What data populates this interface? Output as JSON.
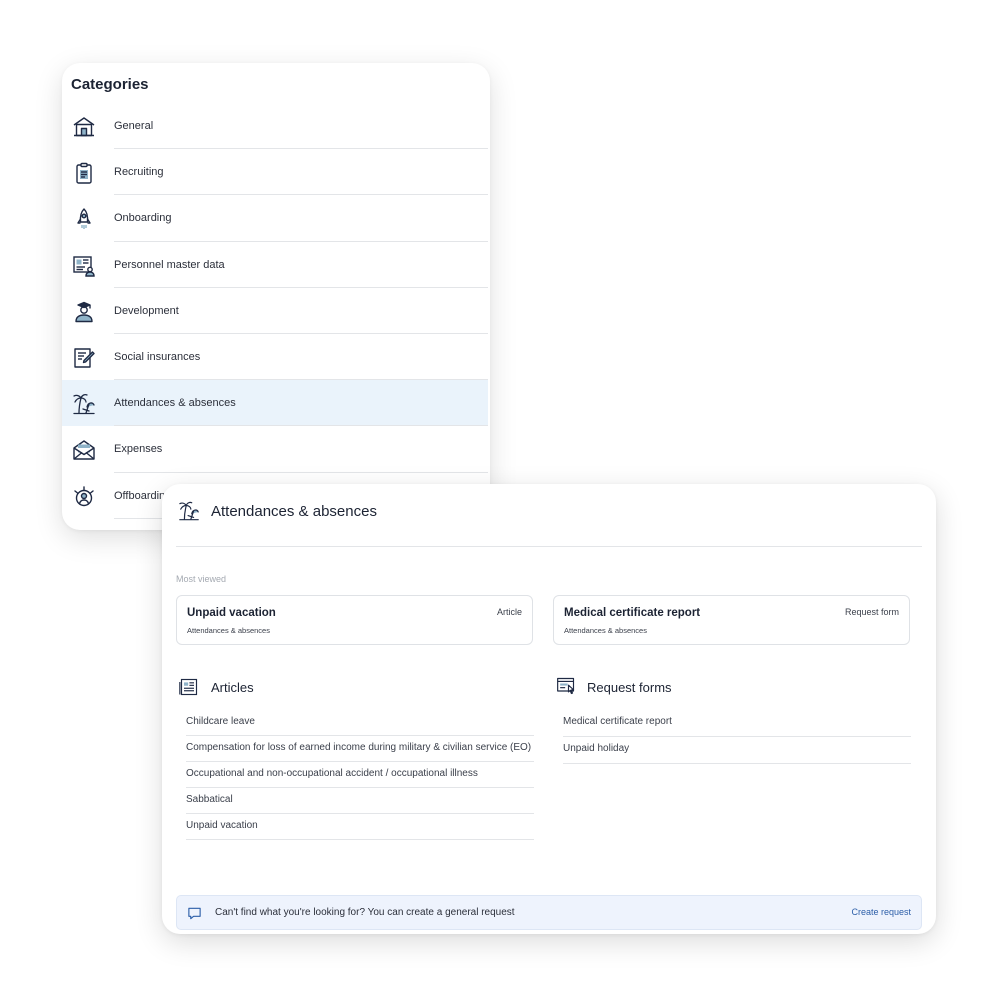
{
  "categories": {
    "title": "Categories",
    "items": [
      {
        "label": "General",
        "icon": "house-icon"
      },
      {
        "label": "Recruiting",
        "icon": "clipboard-icon"
      },
      {
        "label": "Onboarding",
        "icon": "rocket-icon"
      },
      {
        "label": "Personnel master data",
        "icon": "id-card-icon"
      },
      {
        "label": "Development",
        "icon": "graduate-icon"
      },
      {
        "label": "Social insurances",
        "icon": "document-pen-icon"
      },
      {
        "label": "Attendances & absences",
        "icon": "palm-beach-icon",
        "active": true
      },
      {
        "label": "Expenses",
        "icon": "envelope-icon"
      },
      {
        "label": "Offboarding",
        "icon": "person-exit-icon"
      }
    ]
  },
  "detail": {
    "title": "Attendances & absences",
    "most_viewed_label": "Most viewed",
    "most_viewed": [
      {
        "title": "Unpaid vacation",
        "subtitle": "Attendances & absences",
        "type": "Article"
      },
      {
        "title": "Medical certificate report",
        "subtitle": "Attendances & absences",
        "type": "Request form"
      }
    ],
    "articles": {
      "title": "Articles",
      "items": [
        "Childcare leave",
        "Compensation for loss of earned income during military & civilian service (EO)",
        "Occupational and non-occupational accident / occupational illness",
        "Sabbatical",
        "Unpaid vacation"
      ]
    },
    "request_forms": {
      "title": "Request forms",
      "items": [
        "Medical certificate report",
        "Unpaid holiday"
      ]
    },
    "banner": {
      "text": "Can't find what you're looking for? You can create a general request",
      "link": "Create request"
    }
  },
  "colors": {
    "active_row": "#eaf3fb",
    "accent_link": "#2c5ea8",
    "banner_bg": "#eef3fd",
    "icon_dark": "#1f2a44",
    "icon_teal": "#8fb3c8"
  }
}
